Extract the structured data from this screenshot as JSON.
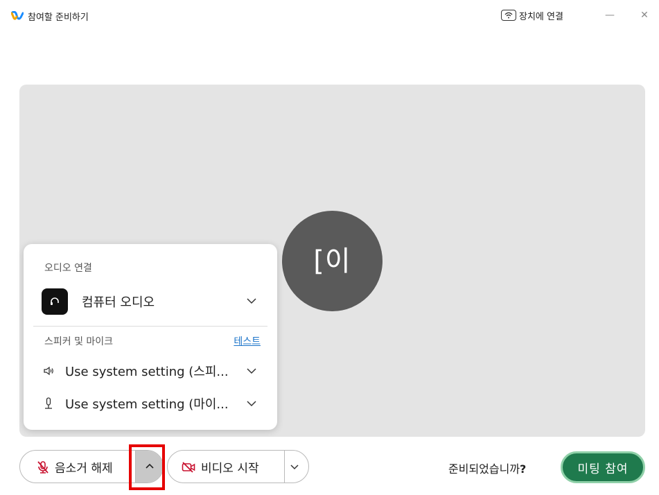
{
  "window": {
    "title": "참여할 준비하기",
    "connect_device_label": "장치에 연결",
    "minimize_glyph": "—",
    "close_glyph": "✕"
  },
  "preview": {
    "avatar_initials": "[이"
  },
  "audio_popup": {
    "heading": "오디오 연결",
    "selected_option": "컴퓨터 오디오",
    "devices_heading": "스피커 및 마이크",
    "test_link": "테스트",
    "speaker_value": "Use system setting (스피...",
    "microphone_value": "Use system setting (마이..."
  },
  "controls": {
    "mute_label": "음소거 해제",
    "video_label": "비디오 시작",
    "ready_prompt": "준비되었습니까",
    "ready_qmark": "?",
    "join_label": "미팅 참여"
  },
  "colors": {
    "join_button": "#1f7a4d",
    "highlight": "#e60000",
    "avatar_bg": "#5a5a5a",
    "link": "#1a73c9"
  }
}
